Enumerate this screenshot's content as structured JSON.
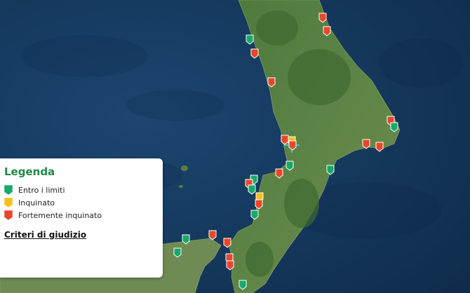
{
  "legend": {
    "title": "Legenda",
    "items": [
      {
        "label": "Entro i limiti",
        "color": "#16a96a"
      },
      {
        "label": "Inquinato",
        "color": "#f2c11d"
      },
      {
        "label": "Fortemente inquinato",
        "color": "#e8472b"
      }
    ],
    "criteria_link": "Criteri di giudizio"
  },
  "markers": [
    {
      "status": "red"
    },
    {
      "status": "red"
    },
    {
      "status": "green"
    },
    {
      "status": "red"
    },
    {
      "status": "red"
    },
    {
      "status": "red"
    },
    {
      "status": "green"
    },
    {
      "status": "red"
    },
    {
      "status": "yellow"
    },
    {
      "status": "red"
    },
    {
      "status": "green"
    },
    {
      "status": "red"
    },
    {
      "status": "green"
    },
    {
      "status": "green"
    },
    {
      "status": "red"
    },
    {
      "status": "green"
    },
    {
      "status": "red"
    },
    {
      "status": "red"
    },
    {
      "status": "yellow"
    },
    {
      "status": "red"
    },
    {
      "status": "green"
    },
    {
      "status": "green"
    },
    {
      "status": "red"
    },
    {
      "status": "green"
    },
    {
      "status": "red"
    },
    {
      "status": "red"
    },
    {
      "status": "red"
    },
    {
      "status": "green"
    }
  ]
}
